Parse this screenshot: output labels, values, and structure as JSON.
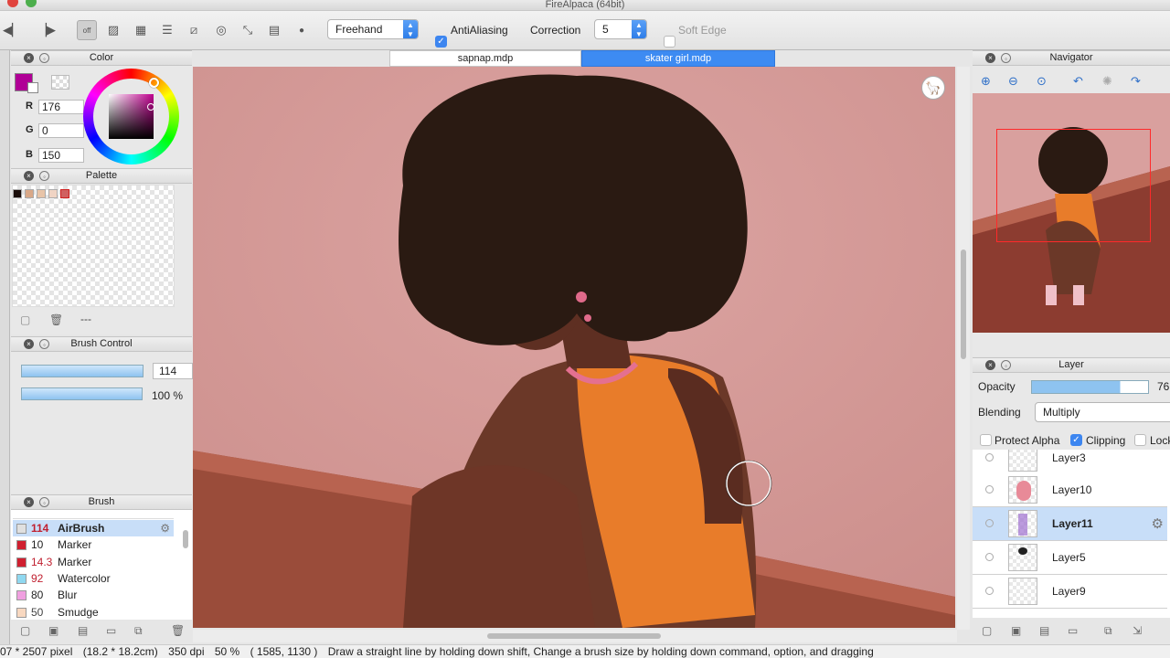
{
  "app": {
    "title": "FireAlpaca (64bit)"
  },
  "toolbar": {
    "mode_select": "Freehand",
    "antialiasing_label": "AntiAliasing",
    "correction_label": "Correction",
    "correction_value": "5",
    "soft_edge_label": "Soft Edge",
    "off_label": "off"
  },
  "color_panel": {
    "title": "Color",
    "r_label": "R",
    "r": "176",
    "g_label": "G",
    "g": "0",
    "b_label": "B",
    "b": "150",
    "current_color": "#b00096"
  },
  "palette_panel": {
    "title": "Palette",
    "swatches": [
      "#1a0d0a",
      "#d9a888",
      "#e8c4a8",
      "#f0d4c4",
      "#d06060"
    ],
    "footer_text": "---"
  },
  "brush_control": {
    "title": "Brush Control",
    "size": "114",
    "opacity": "100 %"
  },
  "brush_panel": {
    "title": "Brush",
    "items": [
      {
        "size": "114",
        "name": "AirBrush",
        "color": "#e0e0e0"
      },
      {
        "size": "10",
        "name": "Marker",
        "color": "#d02030"
      },
      {
        "size": "14.3",
        "name": "Marker",
        "color": "#d02030"
      },
      {
        "size": "92",
        "name": "Watercolor",
        "color": "#8fd8f0"
      },
      {
        "size": "80",
        "name": "Blur",
        "color": "#f0a0e0"
      },
      {
        "size": "50",
        "name": "Smudge",
        "color": "#f8d8c0"
      }
    ]
  },
  "tabs": [
    {
      "label": "sapnap.mdp"
    },
    {
      "label": "skater girl.mdp"
    }
  ],
  "navigator": {
    "title": "Navigator"
  },
  "layer_panel": {
    "title": "Layer",
    "opacity_label": "Opacity",
    "opacity_value": "76",
    "blending_label": "Blending",
    "blending_value": "Multiply",
    "protect_alpha_label": "Protect Alpha",
    "clipping_label": "Clipping",
    "lock_label": "Lock",
    "layers": [
      {
        "name": "Layer3"
      },
      {
        "name": "Layer10"
      },
      {
        "name": "Layer11"
      },
      {
        "name": "Layer5"
      },
      {
        "name": "Layer9"
      }
    ]
  },
  "statusbar": {
    "size": "07 * 2507 pixel",
    "cm": "(18.2 * 18.2cm)",
    "dpi": "350 dpi",
    "zoom": "50 %",
    "coords": "( 1585, 1130 )",
    "hint": "Draw a straight line by holding down shift, Change a brush size by holding down command, option, and dragging"
  }
}
